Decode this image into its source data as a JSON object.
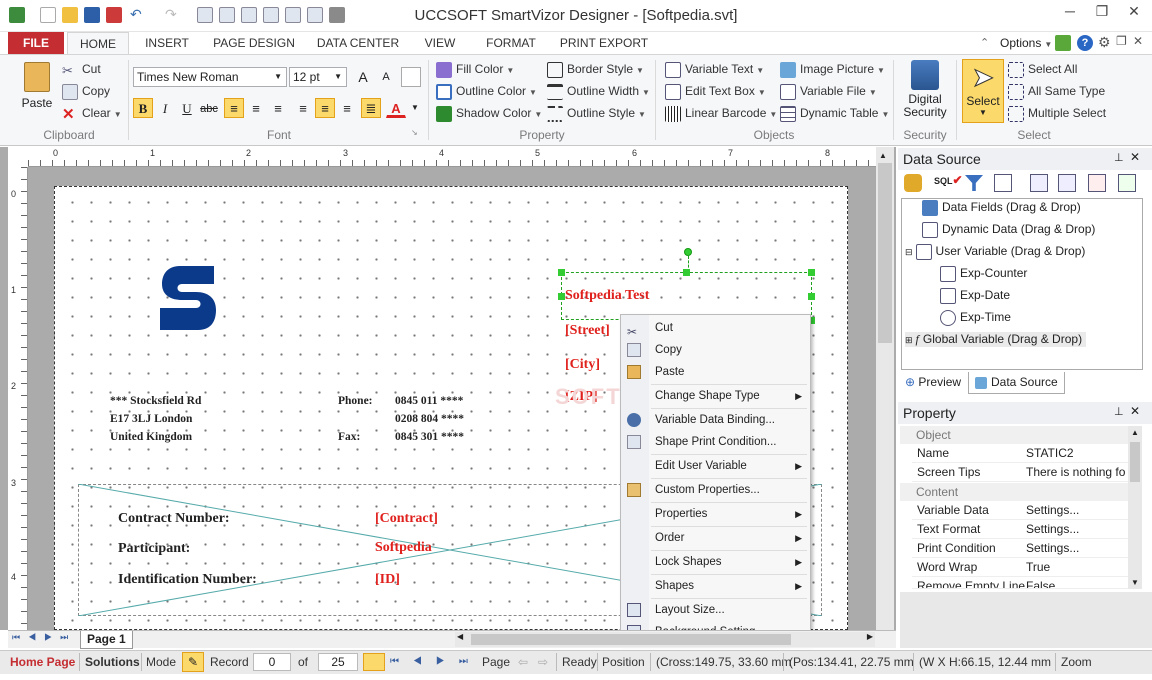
{
  "window": {
    "title": "UCCSOFT SmartVizor Designer - [Softpedia.svt]",
    "minimize": "─",
    "maximize": "❐",
    "close": "✕"
  },
  "tabs": [
    "FILE",
    "HOME",
    "INSERT",
    "PAGE DESIGN",
    "DATA CENTER",
    "VIEW",
    "FORMAT",
    "PRINT EXPORT"
  ],
  "options_label": "Options",
  "ribbon": {
    "clipboard": {
      "paste": "Paste",
      "cut": "Cut",
      "copy": "Copy",
      "clear": "Clear",
      "group": "Clipboard"
    },
    "font": {
      "family": "Times New Roman",
      "size": "12 pt",
      "group": "Font",
      "grow": "A",
      "shrink": "A",
      "bold": "B",
      "italic": "I",
      "underline": "U",
      "strike": "abc",
      "color": "A"
    },
    "property": {
      "fill": "Fill Color",
      "outline": "Outline Color",
      "shadow": "Shadow Color",
      "border_style": "Border Style",
      "outline_width": "Outline Width",
      "outline_style": "Outline Style",
      "group": "Property"
    },
    "objects": {
      "var_text": "Variable Text",
      "edit_text": "Edit Text Box",
      "barcode": "Linear Barcode",
      "image": "Image Picture",
      "var_file": "Variable File",
      "dyn_table": "Dynamic Table",
      "group": "Objects"
    },
    "security": {
      "label1": "Digital",
      "label2": "Security",
      "group": "Security"
    },
    "select": {
      "select": "Select",
      "select_all": "Select All",
      "same_type": "All Same Type",
      "multiple": "Multiple Select",
      "group": "Select"
    }
  },
  "rulers": {
    "h": [
      "0",
      "1",
      "2",
      "3",
      "4",
      "5",
      "6",
      "7",
      "8"
    ],
    "v": [
      "0",
      "1",
      "2",
      "3",
      "4"
    ]
  },
  "doc": {
    "title": "Softpedia Test",
    "street": "[Street]",
    "city": "[City]",
    "zip": "[ZIP]",
    "addr1": "*** Stocksfield Rd",
    "addr2": "E17 3LJ London",
    "addr3": "United Kingdom",
    "phone_label": "Phone:",
    "phone1": "0845 011 ****",
    "phone2": "0208 804 ****",
    "fax_label": "Fax:",
    "fax": "0845 301 ****",
    "contract_label": "Contract Number:",
    "contract_val": "[Contract]",
    "participant_label": "Participant:",
    "participant_val": "Softpedia",
    "id_label": "Identification Number:",
    "id_val": "[ID]",
    "watermark": "SOFTPEDIA"
  },
  "context_menu": [
    {
      "label": "Cut",
      "sub": false
    },
    {
      "label": "Copy",
      "sub": false
    },
    {
      "label": "Paste",
      "sub": false
    },
    {
      "label": "Change Shape Type",
      "sub": true
    },
    {
      "label": "Variable Data Binding...",
      "sub": false
    },
    {
      "label": "Shape Print Condition...",
      "sub": false
    },
    {
      "label": "Edit User Variable",
      "sub": true
    },
    {
      "label": "Custom Properties...",
      "sub": false
    },
    {
      "label": "Properties",
      "sub": true
    },
    {
      "label": "Order",
      "sub": true
    },
    {
      "label": "Lock Shapes",
      "sub": true
    },
    {
      "label": "Shapes",
      "sub": true
    },
    {
      "label": "Layout Size...",
      "sub": false
    },
    {
      "label": "Background Setting...",
      "sub": false
    }
  ],
  "data_source": {
    "title": "Data Source",
    "sql_label": "SQL",
    "items": [
      "Data Fields (Drag & Drop)",
      "Dynamic Data (Drag & Drop)",
      "User Variable (Drag & Drop)",
      "Exp-Counter",
      "Exp-Date",
      "Exp-Time",
      "Global Variable (Drag & Drop)"
    ],
    "tab_preview": "Preview",
    "tab_ds": "Data Source"
  },
  "property": {
    "title": "Property",
    "cat_object": "Object",
    "cat_content": "Content",
    "rows": [
      {
        "k": "Name",
        "v": "STATIC2"
      },
      {
        "k": "Screen Tips",
        "v": "There is nothing fo"
      },
      {
        "k": "Variable Data",
        "v": "Settings..."
      },
      {
        "k": "Text Format",
        "v": "Settings..."
      },
      {
        "k": "Print Condition",
        "v": "Settings..."
      },
      {
        "k": "Word Wrap",
        "v": "True"
      },
      {
        "k": "Remove Empty Line",
        "v": "False"
      }
    ]
  },
  "page_tab": "Page  1",
  "status": {
    "home": "Home Page",
    "solutions": "Solutions",
    "mode": "Mode",
    "record": "Record",
    "rec_val": "0",
    "of": "of",
    "total": "25",
    "page": "Page",
    "ready": "Ready",
    "position": "Position",
    "cross": "(Cross:149.75, 33.60 mm",
    "pos": "(Pos:134.41, 22.75 mm",
    "size": "(W X H:66.15, 12.44 mm",
    "zoom": "Zoom"
  }
}
